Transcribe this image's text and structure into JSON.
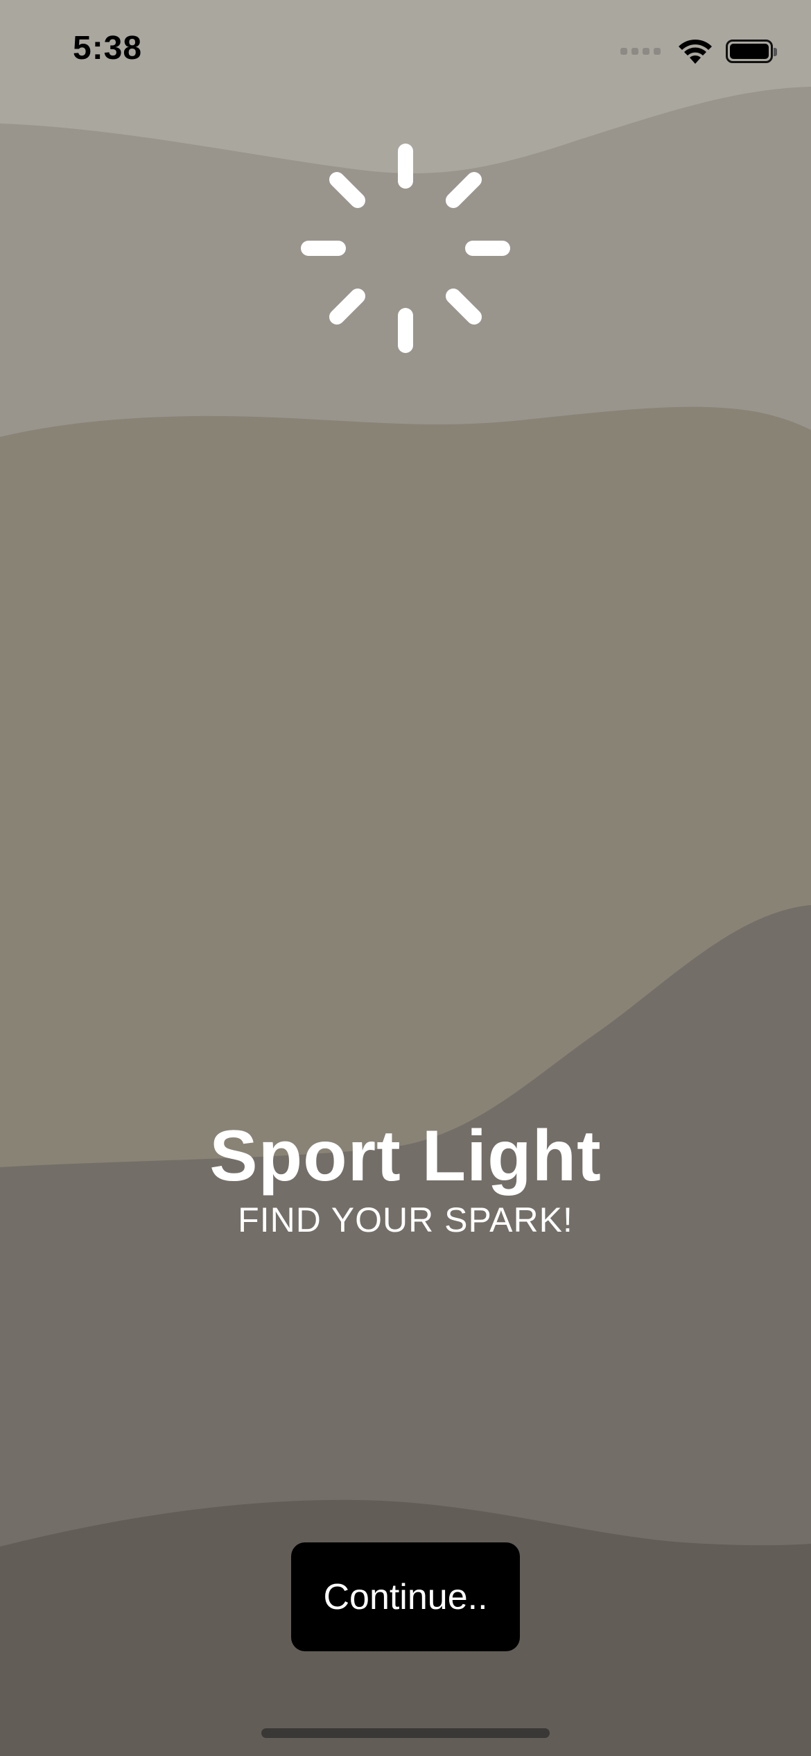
{
  "status_bar": {
    "time": "5:38",
    "signal_icon": "signal-icon",
    "wifi_icon": "wifi-icon",
    "battery_icon": "battery-icon",
    "battery_level": 1.0
  },
  "loading": {
    "icon": "loading-spinner-icon"
  },
  "app": {
    "title": "Sport Light",
    "tagline": "FIND YOUR SPARK!"
  },
  "actions": {
    "continue_label": "Continue.."
  },
  "colors": {
    "layer_top": "#aaa79f",
    "layer_2": "#99958d",
    "layer_3": "#898376",
    "layer_4": "#736e67",
    "layer_bottom": "#625d57",
    "button_bg": "#000000",
    "text": "#ffffff"
  }
}
